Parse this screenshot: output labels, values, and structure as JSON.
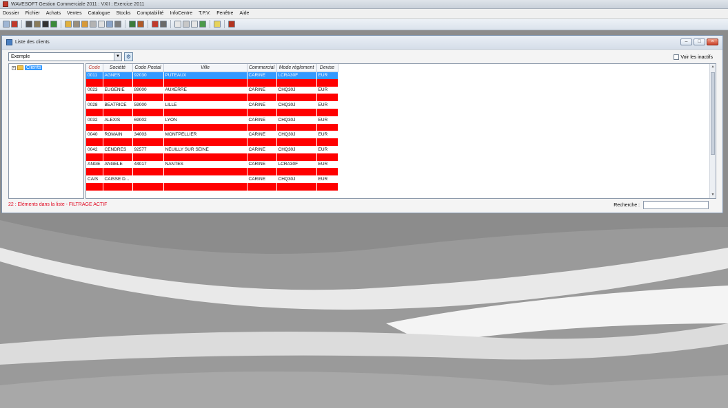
{
  "app": {
    "title": "WAVESOFT Gestion Commerciale 2011 : VXII : Exercice 2011"
  },
  "menu": [
    "Dossier",
    "Fichier",
    "Achats",
    "Ventes",
    "Catalogue",
    "Stocks",
    "Comptabilité",
    "InfoCentre",
    "T.P.V.",
    "Fenêtre",
    "Aide"
  ],
  "window": {
    "title": "Liste des clients",
    "filter_value": "Exemple",
    "inactive_label": "Voir les inactifs",
    "tree_root": "Clients",
    "status": "22 : Eléments dans la liste - FILTRAGE ACTIF",
    "search_label": "Recherche :"
  },
  "grid": {
    "columns": [
      "Code",
      "Société",
      "Code Postal",
      "Ville",
      "Commercial",
      "Mode règlement",
      "Devise"
    ],
    "rows": [
      {
        "style": "sel",
        "cells": [
          "0011",
          "AGNES",
          "92030",
          "PUTEAUX",
          "CARINE",
          "LCRA30F",
          "EUR"
        ]
      },
      {
        "style": "red",
        "cells": [
          "",
          "",
          "",
          "",
          "",
          "",
          ""
        ]
      },
      {
        "style": "white",
        "cells": [
          "0023",
          "EUGENIE",
          "89000",
          "AUXERRE",
          "CARINE",
          "CHQ30J",
          "EUR"
        ]
      },
      {
        "style": "red",
        "cells": [
          "",
          "",
          "",
          "",
          "",
          "",
          ""
        ]
      },
      {
        "style": "white",
        "cells": [
          "0028",
          "BEATRICE",
          "59000",
          "LILLE",
          "CARINE",
          "CHQ30J",
          "EUR"
        ]
      },
      {
        "style": "red",
        "cells": [
          "",
          "",
          "",
          "",
          "",
          "",
          ""
        ]
      },
      {
        "style": "white",
        "cells": [
          "0032",
          "ALEXIS",
          "69002",
          "LYON",
          "CARINE",
          "CHQ30J",
          "EUR"
        ]
      },
      {
        "style": "red",
        "cells": [
          "",
          "",
          "",
          "",
          "",
          "",
          ""
        ]
      },
      {
        "style": "white",
        "cells": [
          "0040",
          "ROMAIN",
          "34003",
          "MONTPELLIER",
          "CARINE",
          "CHQ30J",
          "EUR"
        ]
      },
      {
        "style": "red",
        "cells": [
          "",
          "",
          "",
          "",
          "",
          "",
          ""
        ]
      },
      {
        "style": "white",
        "cells": [
          "0042",
          "CENDRES",
          "92577",
          "NEUILLY SUR SEINE",
          "CARINE",
          "CHQ30J",
          "EUR"
        ]
      },
      {
        "style": "red",
        "cells": [
          "",
          "",
          "",
          "",
          "",
          "",
          ""
        ]
      },
      {
        "style": "white",
        "cells": [
          "ANGE",
          "ANGELE",
          "44017",
          "NANTES",
          "CARINE",
          "LCRA30F",
          "EUR"
        ]
      },
      {
        "style": "red",
        "cells": [
          "",
          "",
          "",
          "",
          "",
          "",
          ""
        ]
      },
      {
        "style": "white",
        "cells": [
          "CAIS",
          "CAISSE D...",
          "",
          "",
          "CARINE",
          "CHQ30J",
          "EUR"
        ]
      },
      {
        "style": "red",
        "cells": [
          "",
          "",
          "",
          "",
          "",
          "",
          ""
        ]
      }
    ]
  },
  "colors": {
    "alert_row": "#ff0000",
    "selection": "#3399ff",
    "status_text": "#e0001a"
  }
}
